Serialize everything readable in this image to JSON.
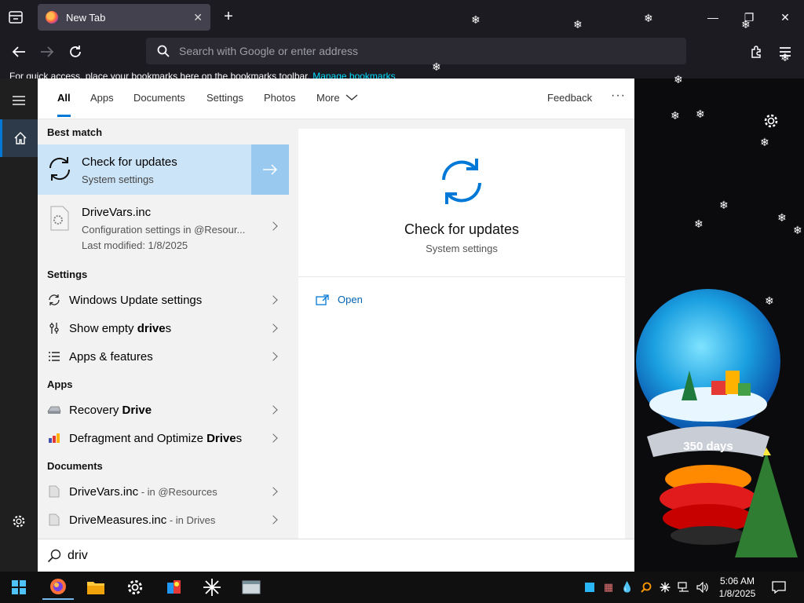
{
  "browser": {
    "tab_title": "New Tab",
    "url_placeholder": "Search with Google or enter address",
    "bookmarks_hint": "For quick access, place your bookmarks here on the bookmarks toolbar.",
    "bookmarks_link": "Manage bookmarks"
  },
  "search": {
    "tabs": [
      "All",
      "Apps",
      "Documents",
      "Settings",
      "Photos",
      "More"
    ],
    "feedback_label": "Feedback",
    "more_options": "···",
    "query": "driv",
    "sections": {
      "best_match": "Best match",
      "settings": "Settings",
      "apps": "Apps",
      "documents": "Documents"
    },
    "best_match": {
      "title": "Check for updates",
      "subtitle": "System settings"
    },
    "drivevars_result": {
      "title": "DriveVars.inc",
      "line1": "Configuration settings in @Resour...",
      "line2": "Last modified: 1/8/2025"
    },
    "settings_items": [
      {
        "pre": "Windows Update settings",
        "bold": "",
        "post": ""
      },
      {
        "pre": "Show empty ",
        "bold": "drive",
        "post": "s"
      },
      {
        "pre": "Apps & features",
        "bold": "",
        "post": ""
      }
    ],
    "app_items": [
      {
        "pre": "Recovery ",
        "bold": "Drive",
        "post": ""
      },
      {
        "pre": "Defragment and Optimize ",
        "bold": "Drive",
        "post": "s"
      }
    ],
    "doc_items": [
      {
        "name": "DriveVars.inc",
        "suffix": " - in @Resources"
      },
      {
        "name": "DriveMeasures.inc",
        "suffix": " - in Drives"
      }
    ],
    "preview": {
      "title": "Check for updates",
      "subtitle": "System settings",
      "open_label": "Open"
    }
  },
  "desktop": {
    "globe_caption": "350 days"
  },
  "taskbar": {
    "time": "5:06 AM",
    "date": "1/8/2025"
  },
  "colors": {
    "accent": "#0078d7",
    "selected_row": "#cce4f7",
    "browser_dark": "#1c1b22"
  }
}
